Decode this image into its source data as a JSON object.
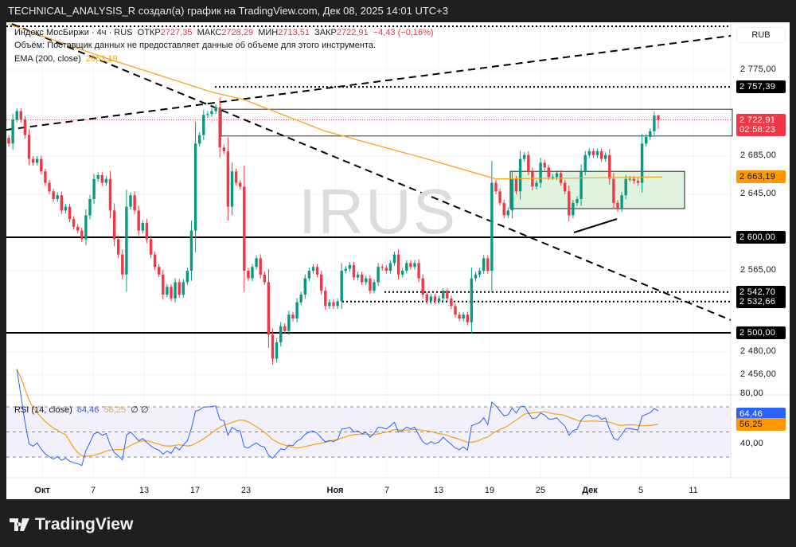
{
  "header": {
    "caption": "TECHNICAL_ANALYSIS_R создал(а) график на TradingView.com, Дек 08, 2025 14:01 UTC+3"
  },
  "legend": {
    "symbol": "Индекс МосБиржи · 4ч · RUS",
    "open_label": "ОТКР",
    "open": "2727,35",
    "high_label": "МАКС",
    "high": "2728,29",
    "low_label": "МИН",
    "low": "2713,51",
    "close_label": "ЗАКР",
    "close": "2722,91",
    "change": "−4,43 (−0,16%)",
    "volume_note": "Объём: Поставщик данных не предоставляет данные об объеме для этого инструмента.",
    "ema_label": "EMA (200, close)",
    "ema_value": "2663,19",
    "rsi_label": "RSI (14, close)",
    "rsi_value": "64,46",
    "rsi_ma_value": "56,25",
    "rsi_extra": "∅ ∅"
  },
  "watermark": "IRUS",
  "currency": "RUB",
  "price_axis": {
    "labels": [
      "2 775,00",
      "2 685,00",
      "2 645,00",
      "2 565,00",
      "2 480,00",
      "2 456,00"
    ]
  },
  "price_tags": [
    {
      "text": "2 757,39",
      "color": "#000000"
    },
    {
      "text": "2 722,91",
      "sub": "02:58:23",
      "color": "#f23645"
    },
    {
      "text": "2 663,19",
      "color": "#ff9800",
      "dark": true
    },
    {
      "text": "2 600,00",
      "color": "#000000"
    },
    {
      "text": "2 542,70",
      "color": "#000000"
    },
    {
      "text": "2 532,66",
      "color": "#000000"
    },
    {
      "text": "2 500,00",
      "color": "#000000"
    }
  ],
  "rsi_axis": {
    "labels": [
      "80,00",
      "40,00"
    ],
    "tags": [
      {
        "text": "64,46",
        "color": "#2962ff"
      },
      {
        "text": "56,25",
        "color": "#ff9800"
      }
    ]
  },
  "time_axis": {
    "labels": [
      "Окт",
      "7",
      "13",
      "17",
      "23",
      "Ноя",
      "7",
      "13",
      "19",
      "25",
      "Дек",
      "5",
      "11"
    ]
  },
  "footer": {
    "brand": "TradingView"
  },
  "colors": {
    "up": "#089981",
    "down": "#f23645",
    "ema": "#f5a623",
    "rsi": "#2962ff",
    "rsi_ma": "#f5a623",
    "zone": "#d7f0d7"
  },
  "chart_data": {
    "type": "candlestick",
    "timeframe": "4h",
    "closes": [
      2698,
      2723,
      2732,
      2723,
      2707,
      2682,
      2678,
      2682,
      2669,
      2657,
      2648,
      2640,
      2644,
      2628,
      2632,
      2619,
      2611,
      2607,
      2598,
      2623,
      2640,
      2661,
      2665,
      2657,
      2661,
      2628,
      2598,
      2582,
      2561,
      2632,
      2644,
      2628,
      2607,
      2615,
      2598,
      2582,
      2569,
      2561,
      2540,
      2548,
      2536,
      2553,
      2540,
      2553,
      2565,
      2607,
      2698,
      2707,
      2728,
      2729,
      2732,
      2736,
      2694,
      2690,
      2632,
      2669,
      2657,
      2653,
      2565,
      2557,
      2569,
      2578,
      2561,
      2553,
      2498,
      2473,
      2490,
      2507,
      2502,
      2519,
      2515,
      2532,
      2540,
      2557,
      2565,
      2569,
      2561,
      2544,
      2528,
      2532,
      2528,
      2533,
      2565,
      2567,
      2571,
      2558,
      2561,
      2553,
      2557,
      2544,
      2553,
      2569,
      2568,
      2565,
      2573,
      2582,
      2561,
      2565,
      2573,
      2569,
      2573,
      2557,
      2540,
      2533,
      2538,
      2533,
      2536,
      2544,
      2536,
      2528,
      2519,
      2515,
      2519,
      2511,
      2557,
      2561,
      2565,
      2578,
      2565,
      2657,
      2648,
      2636,
      2623,
      2628,
      2661,
      2648,
      2682,
      2686,
      2669,
      2653,
      2657,
      2678,
      2673,
      2663,
      2663,
      2667,
      2657,
      2648,
      2623,
      2636,
      2640,
      2669,
      2686,
      2690,
      2686,
      2690,
      2682,
      2686,
      2661,
      2636,
      2630,
      2644,
      2661,
      2661,
      2659,
      2657,
      2698,
      2705,
      2711,
      2727.35,
      2722.91
    ],
    "last_candle": {
      "open": 2727.35,
      "high": 2728.29,
      "low": 2713.51,
      "close": 2722.91
    },
    "ema200": [
      [
        0,
        2823
      ],
      [
        25,
        2786
      ],
      [
        50,
        2752
      ],
      [
        58,
        2744
      ],
      [
        78,
        2711
      ],
      [
        103,
        2682
      ],
      [
        120,
        2661
      ],
      [
        140,
        2662
      ],
      [
        161,
        2663.19
      ]
    ],
    "levels": [
      2757.39,
      2600,
      2542.7,
      2532.66,
      2500
    ],
    "zones": [
      {
        "from": 2706,
        "to": 2734
      },
      {
        "from": 2630,
        "to": 2669
      }
    ],
    "rsi": {
      "period": 14,
      "last": 64.46,
      "ma_last": 56.25,
      "bands": [
        70,
        50,
        30
      ]
    }
  }
}
